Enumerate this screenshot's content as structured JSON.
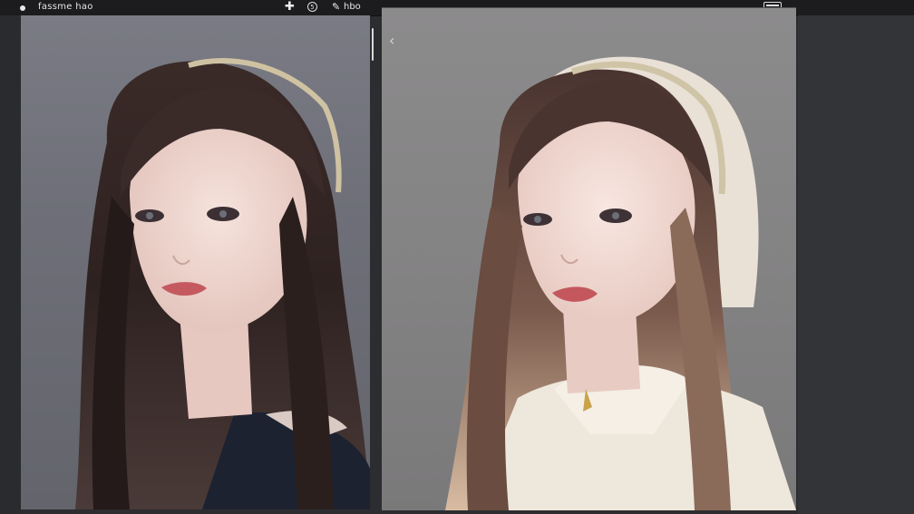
{
  "topbar": {
    "title": "fassme hao",
    "meta": "hbo"
  },
  "icons": {
    "status_dot": "dot-icon",
    "add": "plus-icon",
    "info": "circle-icon",
    "pin": "pin-icon",
    "back": "chevron-left-icon",
    "window": "window-icon"
  },
  "colors": {
    "topbar": "#1c1c1e",
    "canvas": "#2c2d30",
    "left_bg": "#6e6f78",
    "right_bg": "#848384"
  }
}
